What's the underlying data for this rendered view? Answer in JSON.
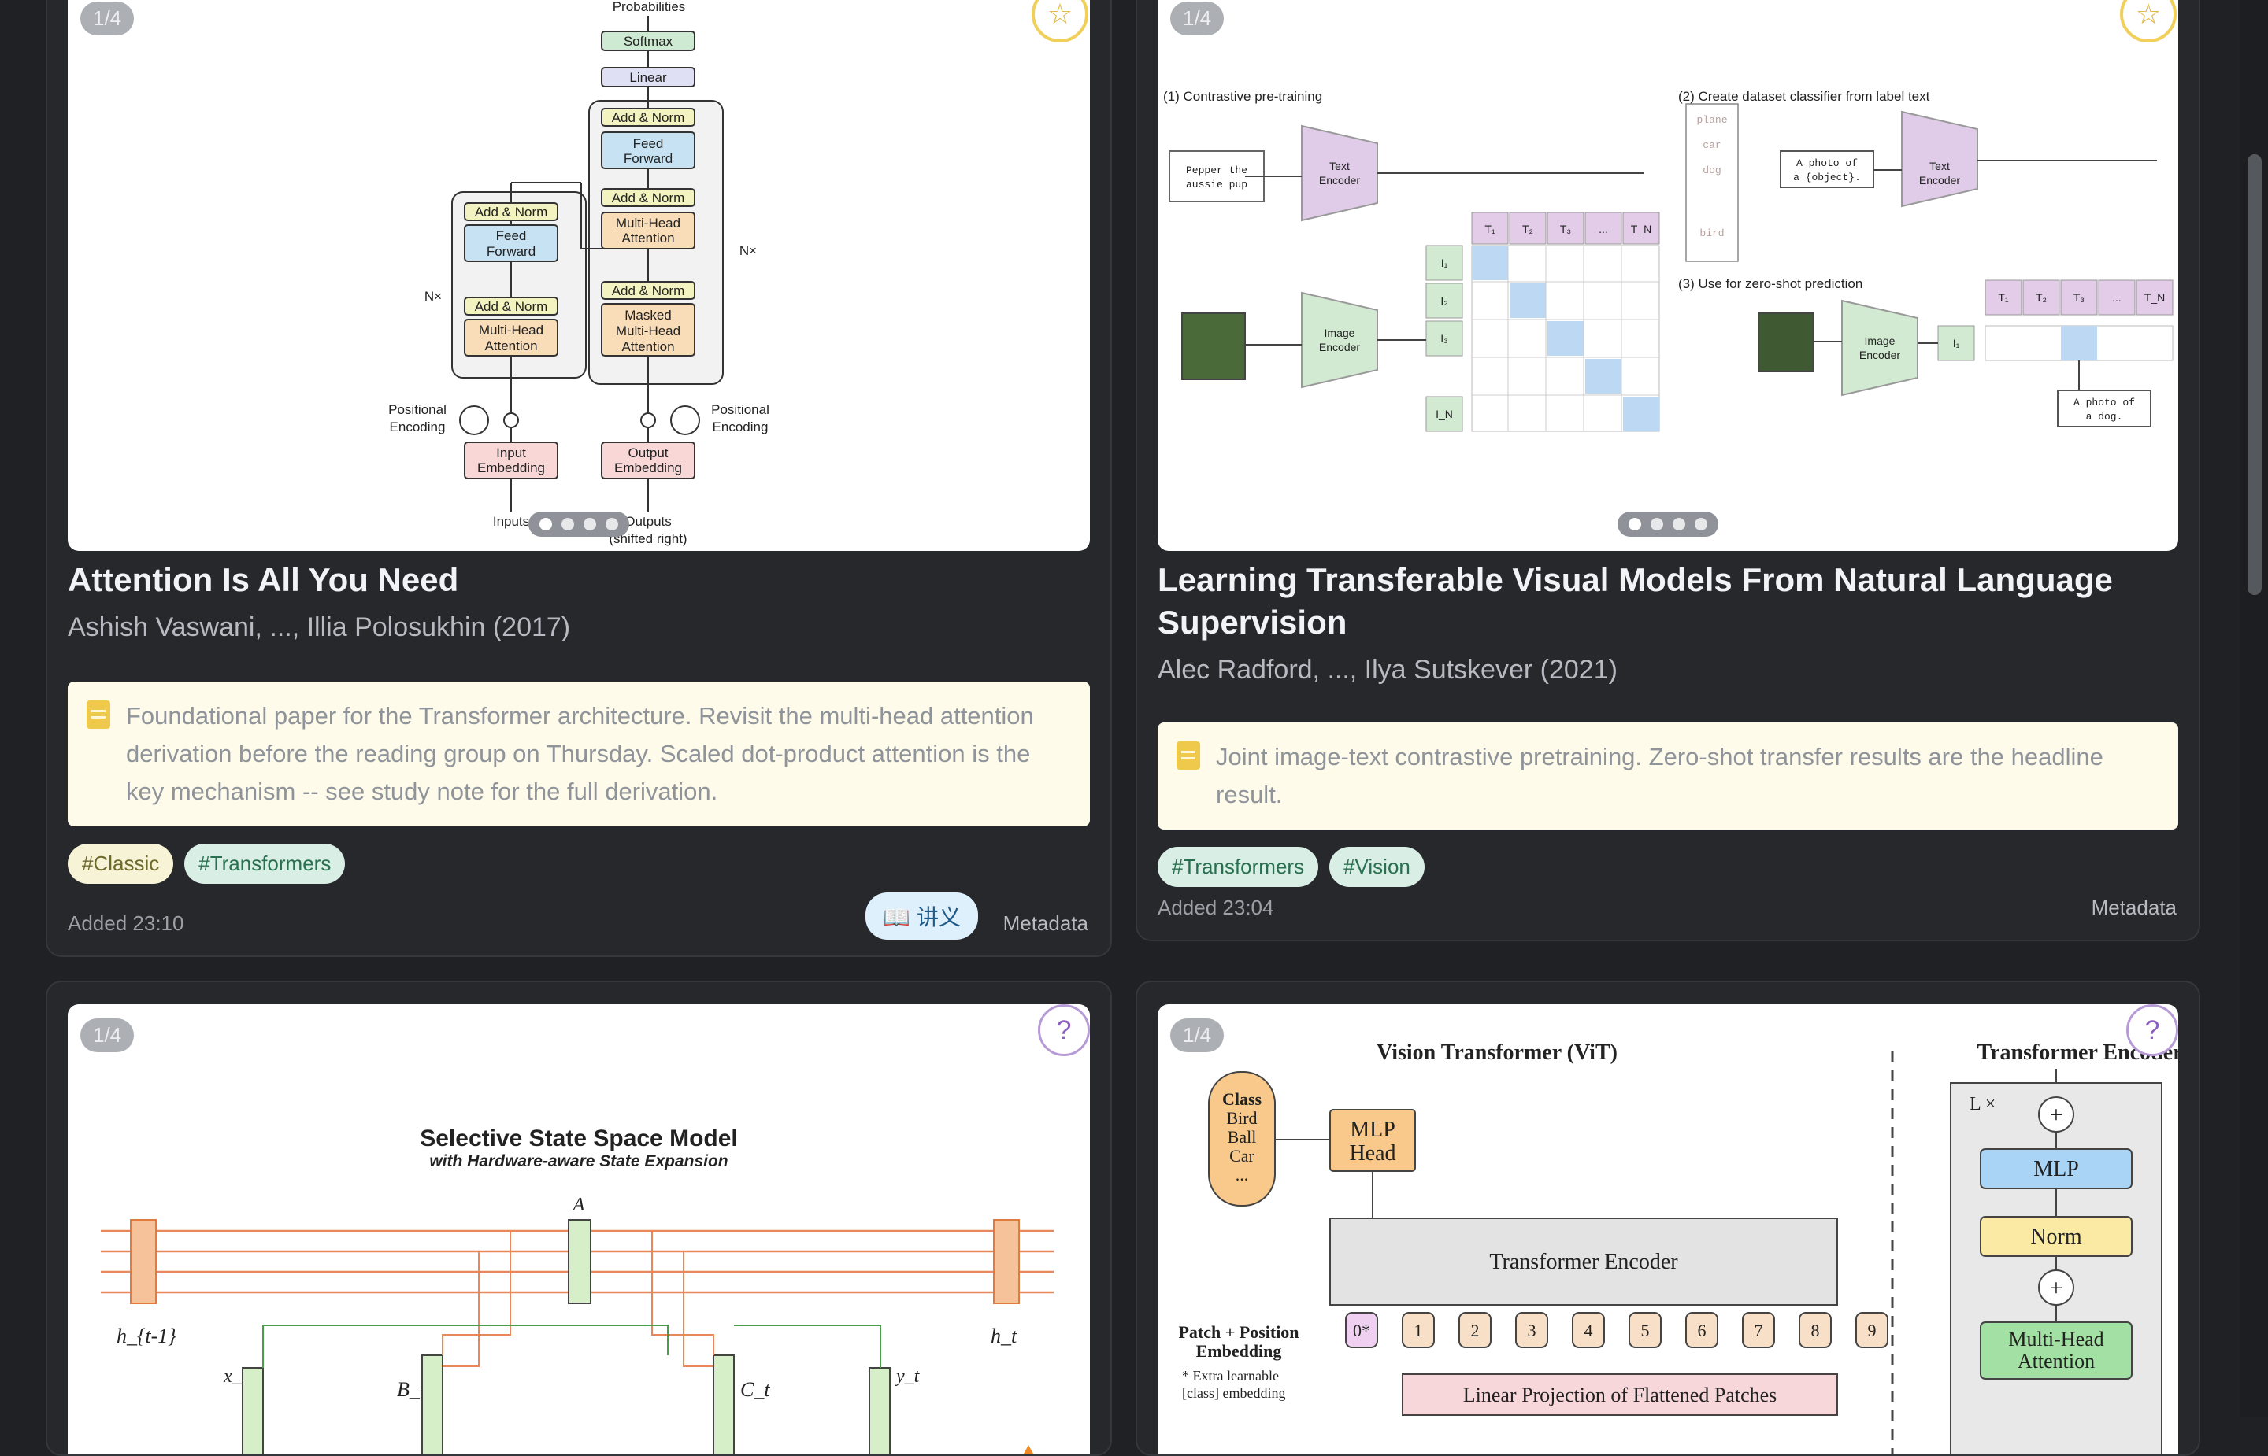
{
  "cards": [
    {
      "page": "1/4",
      "title": "Attention Is All You Need",
      "authors": "Ashish Vaswani, ..., Illia Polosukhin (2017)",
      "note": "Foundational paper for the Transformer architecture. Revisit the multi-head attention derivation before the reading group on Thursday. Scaled dot-product attention is the key mechanism -- see study note for the full derivation.",
      "tags": [
        "#Classic",
        "#Transformers"
      ],
      "added": "Added 23:10",
      "lecture": "讲义",
      "meta": "Metadata",
      "fig": {
        "probabilities": "Probabilities",
        "softmax": "Softmax",
        "linear": "Linear",
        "add_norm": "Add & Norm",
        "feed_forward_1": "Feed",
        "feed_forward_2": "Forward",
        "mha_1": "Multi-Head",
        "mha_2": "Attention",
        "masked": "Masked",
        "nx": "N×",
        "pos_enc_1": "Positional",
        "pos_enc_2": "Encoding",
        "input_emb_1": "Input",
        "input_emb_2": "Embedding",
        "output_emb_1": "Output",
        "output_emb_2": "Embedding",
        "inputs": "Inputs",
        "outputs_1": "Outputs",
        "outputs_2": "(shifted right)"
      }
    },
    {
      "page": "1/4",
      "title": "Learning Transferable Visual Models From Natural Language Supervision",
      "authors": "Alec Radford, ..., Ilya Sutskever (2021)",
      "note": "Joint image-text contrastive pretraining. Zero-shot transfer results are the headline result.",
      "tags": [
        "#Transformers",
        "#Vision"
      ],
      "added": "Added 23:04",
      "meta": "Metadata",
      "fig": {
        "s1": "(1) Contrastive pre-training",
        "s2": "(2) Create dataset classifier from label text",
        "s3": "(3) Use for zero-shot prediction",
        "pepper_1": "Pepper the",
        "pepper_2": "aussie pup",
        "text_enc_1": "Text",
        "text_enc_2": "Encoder",
        "img_enc_1": "Image",
        "img_enc_2": "Encoder",
        "photo_1": "A photo of",
        "photo_2": "a {object}.",
        "photo_dog_1": "A photo of",
        "photo_dog_2": "a dog.",
        "plane": "plane",
        "car": "car",
        "dog": "dog",
        "bird": "bird",
        "t1": "T₁",
        "t2": "T₂",
        "t3": "T₃",
        "tn": "T_N",
        "dots": "...",
        "i1": "I₁",
        "i2": "I₂",
        "i3": "I₃",
        "in": "I_N"
      }
    },
    {
      "page": "1/4",
      "fig": {
        "title": "Selective State Space Model",
        "subtitle": "with Hardware-aware State Expansion",
        "a": "A",
        "h_prev": "h_{t-1}",
        "h_t": "h_t",
        "x_t": "x_t",
        "b_t": "B_t",
        "c_t": "C_t",
        "y_t": "y_t"
      }
    },
    {
      "page": "1/4",
      "fig": {
        "vit_title": "Vision Transformer (ViT)",
        "enc_title": "Transformer Encoder",
        "class_1": "Class",
        "class_2": "Bird",
        "class_3": "Ball",
        "class_4": "Car",
        "class_5": "...",
        "mlp_head_1": "MLP",
        "mlp_head_2": "Head",
        "transformer_encoder": "Transformer Encoder",
        "patch_1": "Patch + Position",
        "patch_2": "Embedding",
        "extra_1": "* Extra learnable",
        "extra_2": "[class] embedding",
        "linear_proj": "Linear Projection of Flattened Patches",
        "lx": "L ×",
        "mlp": "MLP",
        "norm": "Norm",
        "mha_1": "Multi-Head",
        "mha_2": "Attention",
        "tokens": [
          "0*",
          "1",
          "2",
          "3",
          "4",
          "5",
          "6",
          "7",
          "8",
          "9"
        ]
      }
    }
  ]
}
